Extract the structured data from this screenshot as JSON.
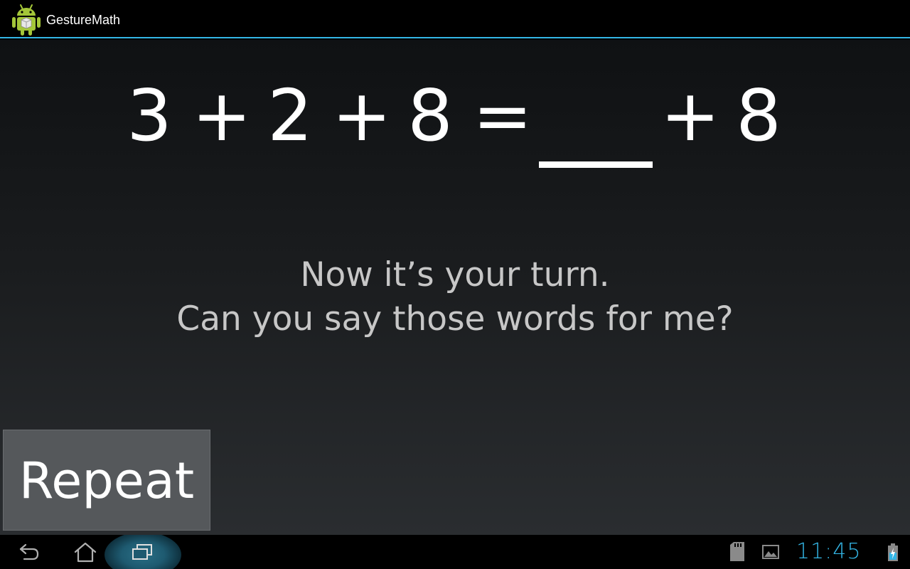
{
  "action_bar": {
    "title": "GestureMath",
    "icon": "android-icon"
  },
  "equation": {
    "tokens": [
      "3",
      "+",
      "2",
      "+",
      "8",
      "=",
      "+",
      "8"
    ],
    "blank": "answer-blank"
  },
  "prompt": {
    "line1": "Now it’s your turn.",
    "line2": "Can you say those words for me?"
  },
  "repeat_button": {
    "label": "Repeat"
  },
  "system_bar": {
    "clock": "11:45",
    "icons": [
      "back-icon",
      "home-icon",
      "recent-apps-icon",
      "sd-card-icon",
      "gallery-icon",
      "battery-charging-icon"
    ]
  },
  "colors": {
    "accent": "#33b5e5",
    "button_bg": "#55585b",
    "background_top": "#0f1113",
    "background_bottom": "#2a2d30"
  }
}
